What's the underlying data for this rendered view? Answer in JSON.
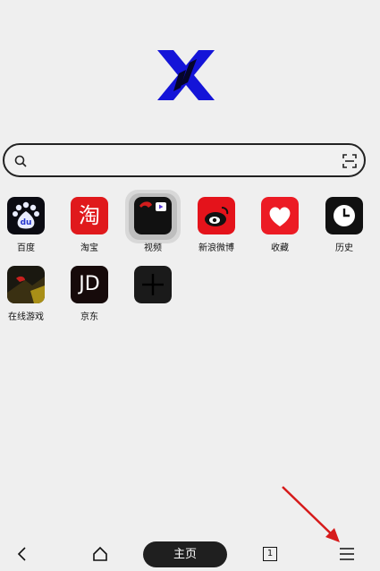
{
  "search": {
    "placeholder": ""
  },
  "shortcuts": [
    {
      "label": "百度",
      "icon": "baidu-icon"
    },
    {
      "label": "淘宝",
      "icon": "taobao-icon",
      "glyph": "淘"
    },
    {
      "label": "视频",
      "icon": "video-icon"
    },
    {
      "label": "新浪微博",
      "icon": "weibo-icon"
    },
    {
      "label": "收藏",
      "icon": "heart-icon"
    },
    {
      "label": "历史",
      "icon": "clock-icon"
    },
    {
      "label": "在线游戏",
      "icon": "game-icon"
    },
    {
      "label": "京东",
      "icon": "jd-icon",
      "glyph": "JD"
    },
    {
      "label": "",
      "icon": "add-icon"
    }
  ],
  "bottom_bar": {
    "home_label": "主页",
    "tab_count": "1"
  },
  "colors": {
    "logo_blue": "#1414d8",
    "accent_red": "#e01818",
    "background": "#efefef",
    "dark": "#1f1f1f",
    "annotation_arrow": "#d61a1a"
  }
}
